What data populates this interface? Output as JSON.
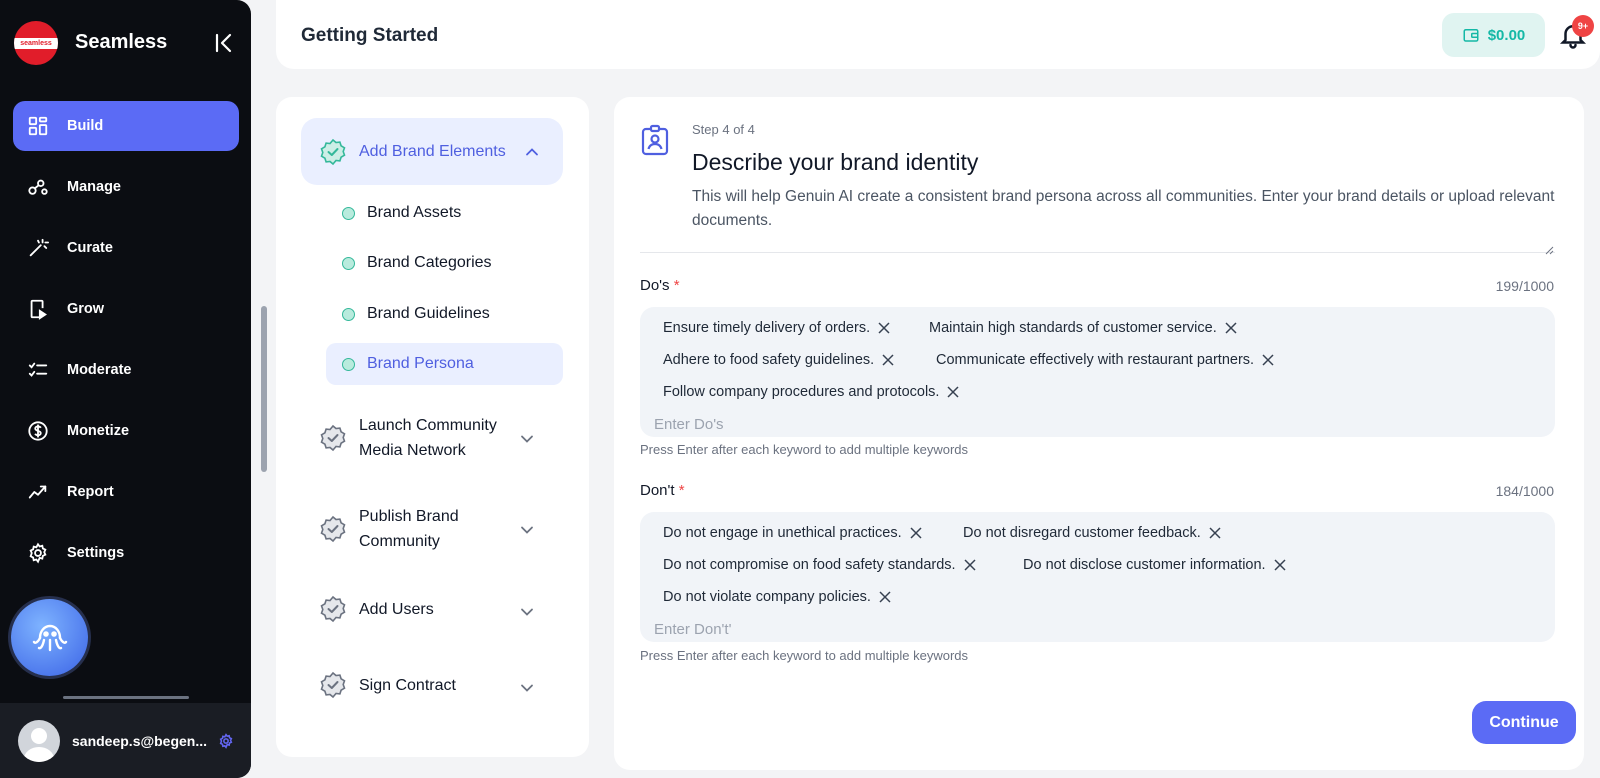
{
  "sidebar": {
    "logo_text": "seamless",
    "app_name": "Seamless",
    "nav": [
      {
        "label": "Build",
        "icon": "grid-icon",
        "active": true
      },
      {
        "label": "Manage",
        "icon": "nodes-icon"
      },
      {
        "label": "Curate",
        "icon": "magic-wand-icon"
      },
      {
        "label": "Grow",
        "icon": "phone-growth-icon"
      },
      {
        "label": "Moderate",
        "icon": "checklist-icon"
      },
      {
        "label": "Monetize",
        "icon": "dollar-icon"
      },
      {
        "label": "Report",
        "icon": "trend-icon"
      },
      {
        "label": "Settings",
        "icon": "gear-icon"
      }
    ],
    "user_email": "sandeep.s@begen..."
  },
  "header": {
    "title": "Getting Started",
    "wallet_amount": "$0.00",
    "notification_badge": "9+"
  },
  "steps": {
    "active": {
      "label": "Add Brand Elements"
    },
    "sub_items": [
      {
        "label": "Brand Assets"
      },
      {
        "label": "Brand Categories"
      },
      {
        "label": "Brand Guidelines"
      },
      {
        "label": "Brand Persona",
        "active": true
      }
    ],
    "others": [
      {
        "label": "Launch Community Media Network"
      },
      {
        "label": "Publish Brand Community"
      },
      {
        "label": "Add Users"
      },
      {
        "label": "Sign Contract"
      }
    ]
  },
  "form": {
    "step_count": "Step 4 of 4",
    "title": "Describe your brand identity",
    "description": "This will help Genuin AI create a consistent brand persona across all communities. Enter your brand details or upload relevant documents.",
    "dos": {
      "label": "Do's",
      "required_mark": "*",
      "counter": "199/1000",
      "tags": [
        "Ensure timely delivery of orders.",
        "Maintain high standards of customer service.",
        "Adhere to food safety guidelines.",
        "Communicate effectively with restaurant partners.",
        "Follow company procedures and protocols."
      ],
      "placeholder": "Enter Do's",
      "hint": "Press Enter after each keyword to add multiple keywords"
    },
    "donts": {
      "label": "Don't",
      "required_mark": "*",
      "counter": "184/1000",
      "tags": [
        "Do not engage in unethical practices.",
        "Do not disregard customer feedback.",
        "Do not compromise on food safety standards.",
        "Do not disclose customer information.",
        "Do not violate company policies."
      ],
      "placeholder": "Enter Don't'",
      "hint": "Press Enter after each keyword to add multiple keywords"
    },
    "continue_label": "Continue"
  },
  "colors": {
    "accent": "#5b6bf5",
    "sidebar_bg": "#0b0d12",
    "wallet_teal": "#14b8a6",
    "required_red": "#ef4444"
  }
}
